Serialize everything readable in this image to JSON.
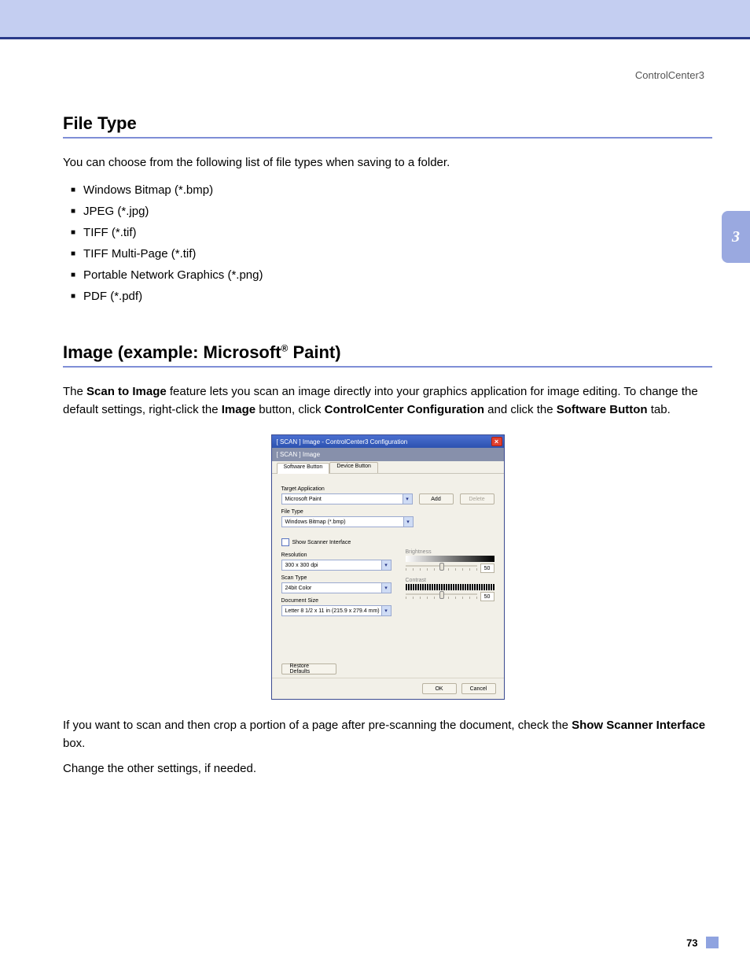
{
  "header": {
    "right": "ControlCenter3"
  },
  "chapter_tab": "3",
  "page_number": "73",
  "section1": {
    "title": "File Type",
    "intro": "You can choose from the following list of file types when saving to a folder.",
    "items": [
      "Windows Bitmap (*.bmp)",
      "JPEG (*.jpg)",
      "TIFF (*.tif)",
      "TIFF Multi-Page (*.tif)",
      "Portable Network Graphics (*.png)",
      "PDF (*.pdf)"
    ]
  },
  "section2": {
    "title_pre": "Image (example: Microsoft",
    "title_sup": "®",
    "title_post": " Paint)",
    "para1_a": "The ",
    "para1_b": "Scan to Image",
    "para1_c": " feature lets you scan an image directly into your graphics application for image editing. To change the default settings, right-click the ",
    "para1_d": "Image",
    "para1_e": " button, click ",
    "para1_f": "ControlCenter Configuration",
    "para1_g": " and click the ",
    "para1_h": "Software Button",
    "para1_i": " tab.",
    "para2_a": "If you want to scan and then crop a portion of a page after pre-scanning the document, check the ",
    "para2_b": "Show Scanner Interface",
    "para2_c": " box.",
    "para3": "Change the other settings, if needed."
  },
  "dialog": {
    "title": "[ SCAN ]   Image - ControlCenter3 Configuration",
    "subtitle": "[ SCAN ]   Image",
    "tabs": {
      "active": "Software Button",
      "inactive": "Device Button"
    },
    "labels": {
      "target_app": "Target Application",
      "file_type": "File Type",
      "show_scanner": "Show Scanner Interface",
      "resolution": "Resolution",
      "scan_type": "Scan Type",
      "document_size": "Document Size",
      "brightness": "Brightness",
      "contrast": "Contrast"
    },
    "values": {
      "target_app": "Microsoft Paint",
      "file_type": "Windows Bitmap (*.bmp)",
      "resolution": "300 x 300 dpi",
      "scan_type": "24bit Color",
      "document_size": "Letter 8 1/2 x 11 in (215.9 x 279.4 mm)",
      "brightness": "50",
      "contrast": "50"
    },
    "buttons": {
      "add": "Add",
      "delete": "Delete",
      "restore": "Restore Defaults",
      "ok": "OK",
      "cancel": "Cancel"
    }
  }
}
